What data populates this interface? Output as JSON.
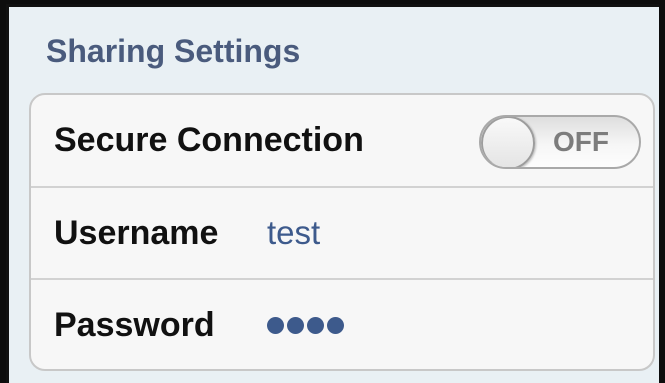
{
  "section": {
    "title": "Sharing Settings"
  },
  "settings": {
    "secure_connection": {
      "label": "Secure Connection",
      "toggle_state": "OFF"
    },
    "username": {
      "label": "Username",
      "value": "test"
    },
    "password": {
      "label": "Password",
      "masked_length": 4
    }
  },
  "colors": {
    "header_text": "#4a5b7d",
    "value_text": "#3d5a8c",
    "background": "#e9f0f4"
  }
}
